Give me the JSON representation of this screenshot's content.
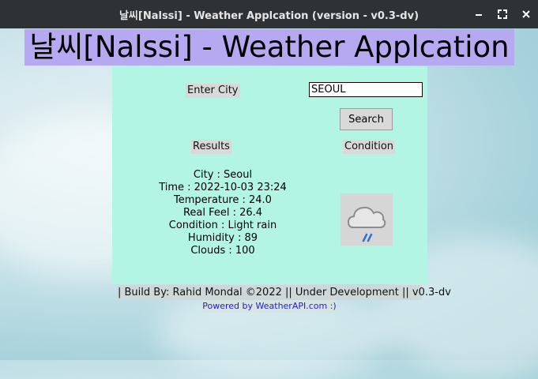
{
  "window": {
    "title": "날씨[Nalssi] - Weather Applcation (version - v0.3-dv)",
    "controls": [
      "minimize-icon",
      "maximize-icon",
      "close-icon"
    ]
  },
  "app": {
    "heading": "날씨[Nalssi] - Weather Applcation"
  },
  "form": {
    "city_label": "Enter City",
    "city_value": "SEOUL",
    "search_label": "Search"
  },
  "results": {
    "header": "Results",
    "condition_header": "Condition",
    "city": "City : Seoul",
    "time": "Time : 2022-10-03 23:24",
    "temperature": "Temperature : 24.0",
    "real_feel": "Real Feel : 26.4",
    "condition": "Condition : Light rain",
    "humidity": "Humidity : 89",
    "clouds": "Clouds : 100",
    "condition_icon": "light-rain-cloud-icon"
  },
  "footer": {
    "build": "| Build By: Rahid Mondal ©2022 || Under Development || v0.3-dv",
    "powered": "Powered by WeatherAPI.com :)"
  },
  "colors": {
    "title_bar": "#2f3235",
    "heading_bg": "#b6a9f2",
    "panel_bg": "#b3f5e3",
    "link": "#1d1ddc",
    "rain": "#2a6fd6"
  }
}
